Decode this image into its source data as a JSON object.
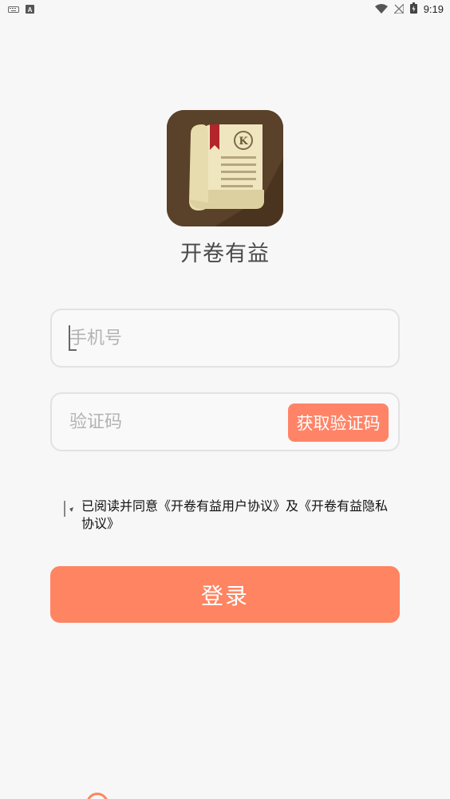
{
  "status_bar": {
    "time": "9:19",
    "left_icons": [
      "keyboard-icon",
      "a-notification-icon"
    ],
    "right_icons": [
      "wifi-icon",
      "no-signal-icon",
      "battery-icon"
    ]
  },
  "app": {
    "logo_icon": "book-logo-icon",
    "logo_letter": "K",
    "name": "开卷有益"
  },
  "form": {
    "phone_placeholder": "手机号",
    "phone_value": "",
    "code_placeholder": "验证码",
    "code_value": "",
    "get_code_label": "获取验证码"
  },
  "agreement": {
    "text": "已阅读并同意《开卷有益用户协议》及《开卷有益隐私协议》"
  },
  "login": {
    "label": "登录"
  },
  "colors": {
    "accent": "#ff8461",
    "background": "#f7f7f7",
    "logo_bg": "#5a4129"
  }
}
